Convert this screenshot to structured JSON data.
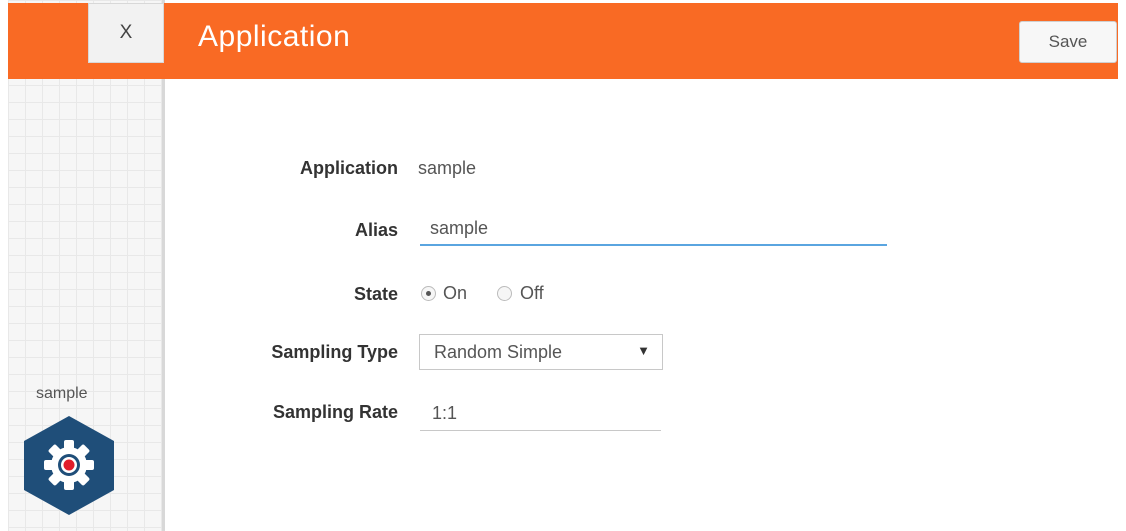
{
  "header": {
    "close_label": "X",
    "title": "Application",
    "save_label": "Save",
    "accent_color": "#f96a24"
  },
  "canvas": {
    "node_label": "sample",
    "node_icon": "gear-icon",
    "node_color": "#1f4e79"
  },
  "form": {
    "application": {
      "label": "Application",
      "value": "sample"
    },
    "alias": {
      "label": "Alias",
      "value": "sample"
    },
    "state": {
      "label": "State",
      "options": [
        {
          "label": "On",
          "checked": true
        },
        {
          "label": "Off",
          "checked": false
        }
      ]
    },
    "sampling_type": {
      "label": "Sampling Type",
      "selected": "Random Simple"
    },
    "sampling_rate": {
      "label": "Sampling Rate",
      "value": "1:1"
    }
  }
}
